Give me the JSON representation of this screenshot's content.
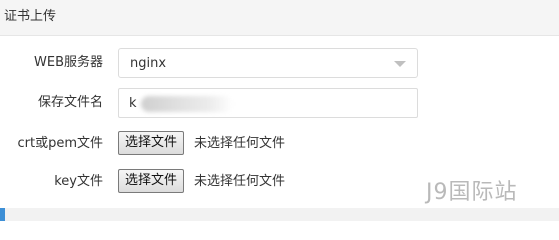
{
  "panel": {
    "title": "证书上传"
  },
  "form": {
    "web_server": {
      "label": "WEB服务器",
      "selected": "nginx"
    },
    "filename": {
      "label": "保存文件名",
      "value": "k"
    },
    "crt_file": {
      "label": "crt或pem文件",
      "button": "选择文件",
      "status": "未选择任何文件"
    },
    "key_file": {
      "label": "key文件",
      "button": "选择文件",
      "status": "未选择任何文件"
    }
  },
  "watermark": {
    "text": "J9国际站"
  },
  "colors": {
    "accent": "#3d8fd6",
    "header_bg": "#f5f5f5",
    "border": "#dcdcdc"
  }
}
